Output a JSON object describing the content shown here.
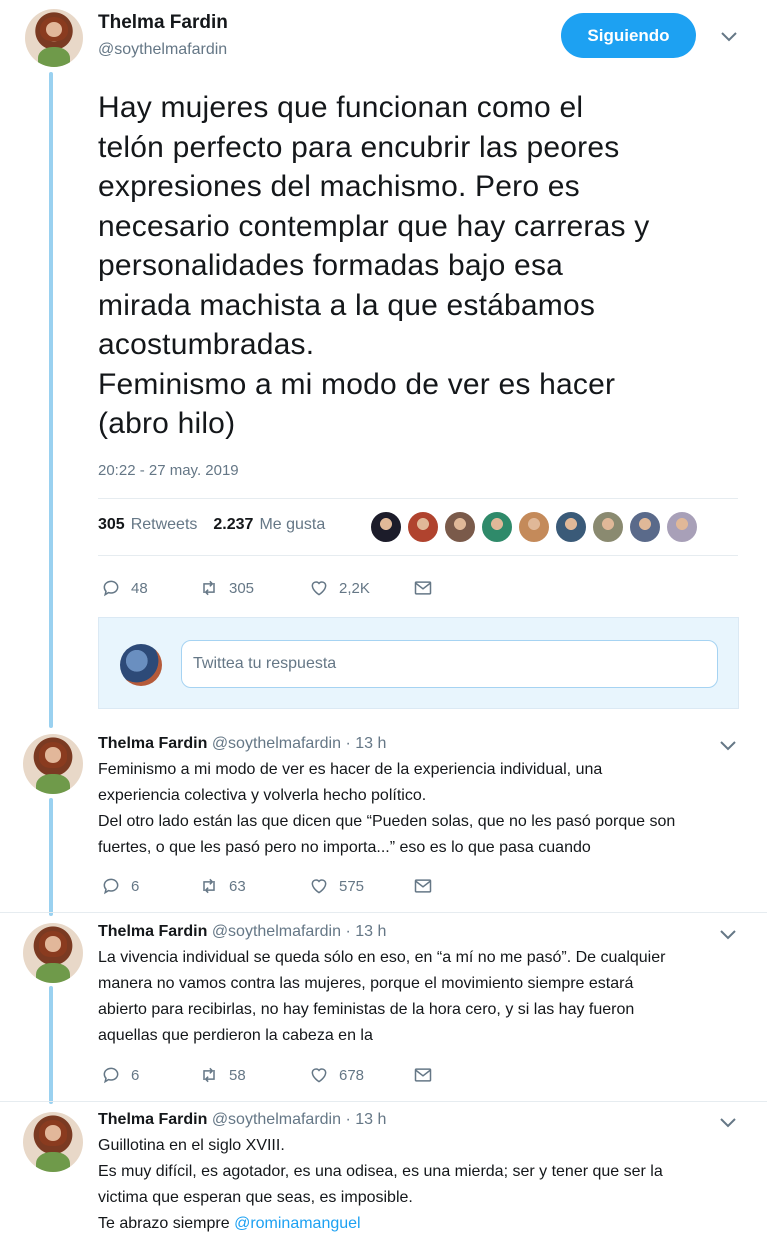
{
  "main_tweet": {
    "name": "Thelma Fardin",
    "handle": "@soythelmafardin",
    "follow_label": "Siguiendo",
    "text": "Hay mujeres que funcionan como el\ntelón perfecto para encubrir las peores\nexpresiones del machismo. Pero es\nnecesario contemplar que hay carreras y\npersonalidades formadas bajo esa\nmirada machista a la que estábamos\nacostumbradas.\nFeminismo a mi modo de ver es hacer\n(abro hilo)",
    "timestamp": "20:22 - 27 may. 2019",
    "retweets_count": "305",
    "retweets_label": "Retweets",
    "likes_count": "2.237",
    "likes_label": "Me gusta",
    "liker_colors": [
      "#1c1c2a",
      "#b0432e",
      "#7a5a4a",
      "#2f8a6a",
      "#c48a5a",
      "#3a5a78",
      "#8a8a70",
      "#5a6a8a",
      "#a8a0b8"
    ],
    "actions": {
      "replies": "48",
      "retweets": "305",
      "likes": "2,2K"
    }
  },
  "reply_box": {
    "placeholder": "Twittea tu respuesta"
  },
  "replies": [
    {
      "name": "Thelma Fardin",
      "handle": "@soythelmafardin",
      "time": "· 13 h",
      "lines": [
        "Feminismo a mi modo de ver es hacer de la experiencia individual, una",
        "experiencia colectiva y volverla hecho político.",
        "Del otro lado están las que dicen que “Pueden solas, que no les pasó porque son",
        "fuertes, o que les pasó pero no importa...” eso es lo que pasa cuando"
      ],
      "actions": {
        "replies": "6",
        "retweets": "63",
        "likes": "575"
      }
    },
    {
      "name": "Thelma Fardin",
      "handle": "@soythelmafardin",
      "time": "· 13 h",
      "lines": [
        "La vivencia individual se queda sólo en eso, en “a mí no me pasó”. De cualquier",
        "manera no vamos contra las mujeres, porque el movimiento siempre estará",
        "abierto para recibirlas, no hay feministas de la hora cero, y si las hay fueron",
        "aquellas que perdieron la cabeza en la"
      ],
      "actions": {
        "replies": "6",
        "retweets": "58",
        "likes": "678"
      }
    },
    {
      "name": "Thelma Fardin",
      "handle": "@soythelmafardin",
      "time": "· 13 h",
      "lines": [
        "Guillotina en el siglo XVIII.",
        "Es muy difícil, es agotador, es una odisea, es una mierda; ser y tener que ser la",
        "victima que esperan que seas, es imposible.",
        "Te abrazo siempre"
      ],
      "mention": "@rominamanguel"
    }
  ]
}
